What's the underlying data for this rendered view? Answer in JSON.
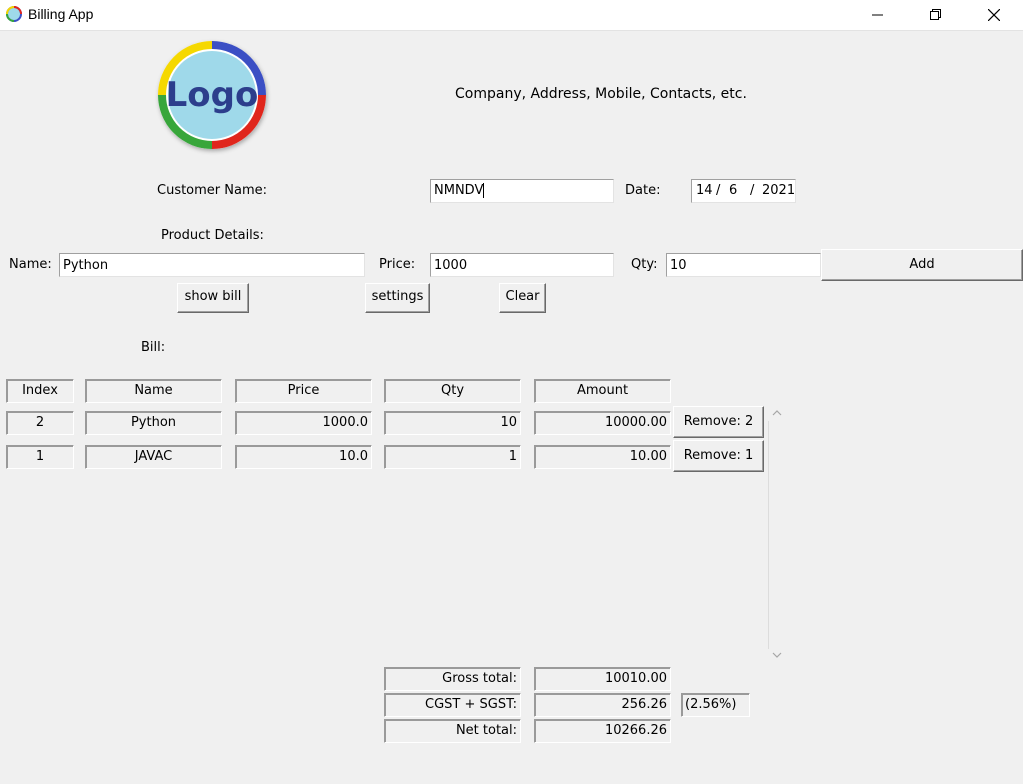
{
  "window": {
    "title": "Billing App"
  },
  "header": {
    "logo_text": "Logo",
    "company_info": "Company, Address, Mobile, Contacts, etc."
  },
  "customer": {
    "name_label": "Customer Name:",
    "name_value": "NMNDV",
    "date_label": "Date:",
    "date_day": "14",
    "date_month": "6",
    "date_year": "2021",
    "date_sep": "/"
  },
  "product": {
    "section_label": "Product Details:",
    "name_label": "Name:",
    "name_value": "Python",
    "price_label": "Price:",
    "price_value": "1000",
    "qty_label": "Qty:",
    "qty_value": "10",
    "add_label": "Add"
  },
  "actions": {
    "show_bill": "show bill",
    "settings": "settings",
    "clear": "Clear"
  },
  "bill": {
    "label": "Bill:",
    "headers": [
      "Index",
      "Name",
      "Price",
      "Qty",
      "Amount"
    ],
    "rows": [
      {
        "index": "2",
        "name": "Python",
        "price": "1000.0",
        "qty": "10",
        "amount": "10000.00",
        "remove": "Remove: 2"
      },
      {
        "index": "1",
        "name": "JAVAC",
        "price": "10.0",
        "qty": "1",
        "amount": "10.00",
        "remove": "Remove: 1"
      }
    ]
  },
  "totals": {
    "gross_label": "Gross total:",
    "gross_value": "10010.00",
    "tax_label": "CGST + SGST:",
    "tax_value": "256.26",
    "tax_rate": "(2.56%)",
    "net_label": "Net total:",
    "net_value": "10266.26"
  },
  "colors": {
    "logo_yellow": "#f5d800",
    "logo_blue": "#3b4fc4",
    "logo_red": "#e0261f",
    "logo_green": "#37a63b",
    "logo_fill": "#9fd9ea"
  }
}
